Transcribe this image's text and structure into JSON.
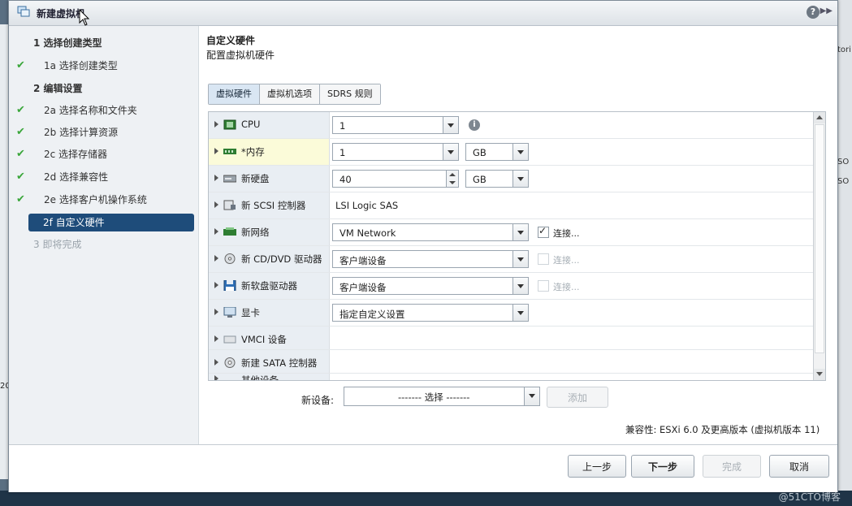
{
  "window": {
    "title": "新建虚拟机"
  },
  "steps": [
    {
      "label": "1 选择创建类型",
      "type": "major",
      "done": false
    },
    {
      "label": "1a 选择创建类型",
      "type": "sub",
      "done": true
    },
    {
      "label": "2 编辑设置",
      "type": "major",
      "done": false
    },
    {
      "label": "2a 选择名称和文件夹",
      "type": "sub",
      "done": true
    },
    {
      "label": "2b 选择计算资源",
      "type": "sub",
      "done": true
    },
    {
      "label": "2c 选择存储器",
      "type": "sub",
      "done": true
    },
    {
      "label": "2d 选择兼容性",
      "type": "sub",
      "done": true
    },
    {
      "label": "2e 选择客户机操作系统",
      "type": "sub",
      "done": true
    },
    {
      "label": "2f 自定义硬件",
      "type": "active",
      "done": false
    },
    {
      "label": "3 即将完成",
      "type": "disabled",
      "done": false
    }
  ],
  "main": {
    "title": "自定义硬件",
    "subtitle": "配置虚拟机硬件"
  },
  "tabs": [
    "虚拟硬件",
    "虚拟机选项",
    "SDRS 规则"
  ],
  "hardware": {
    "cpu": {
      "name": "CPU",
      "value": "1"
    },
    "memory": {
      "name": "*内存",
      "value": "1",
      "unit": "GB"
    },
    "disk": {
      "name": "新硬盘",
      "value": "40",
      "unit": "GB"
    },
    "scsi": {
      "name": "新 SCSI 控制器",
      "value": "LSI Logic SAS"
    },
    "network": {
      "name": "新网络",
      "value": "VM Network",
      "connect": "连接..."
    },
    "cdrom": {
      "name": "新 CD/DVD 驱动器",
      "value": "客户端设备",
      "connect": "连接..."
    },
    "floppy": {
      "name": "新软盘驱动器",
      "value": "客户端设备",
      "connect": "连接..."
    },
    "video": {
      "name": "显卡",
      "value": "指定自定义设置"
    },
    "vmci": {
      "name": "VMCI 设备"
    },
    "sata": {
      "name": "新建 SATA 控制器"
    },
    "other": {
      "name": "其他设备"
    }
  },
  "new_device": {
    "label": "新设备:",
    "value": "------- 选择 -------",
    "add": "添加"
  },
  "compat": "兼容性: ESXi 6.0 及更高版本 (虚拟机版本 11)",
  "buttons": {
    "back": "上一步",
    "next": "下一步",
    "finish": "完成",
    "cancel": "取消"
  },
  "background": {
    "right_a": "tori",
    "right_b": "SO",
    "right_c": "SO",
    "left_a": "20"
  },
  "watermark": "@51CTO博客"
}
